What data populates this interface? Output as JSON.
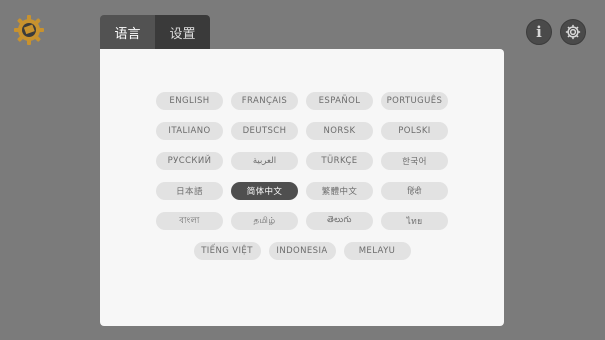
{
  "app": {
    "icons": {
      "logo": "gear-sun-logo",
      "info": "info-icon",
      "settings": "gear-icon"
    },
    "info_glyph": "i"
  },
  "tabs": [
    {
      "label": "语言",
      "active": true
    },
    {
      "label": "设置",
      "active": false
    }
  ],
  "languages": {
    "selected": "简体中文",
    "rows": [
      [
        "ENGLISH",
        "FRANÇAIS",
        "ESPAÑOL",
        "PORTUGUÊS"
      ],
      [
        "ITALIANO",
        "DEUTSCH",
        "NORSK",
        "POLSKI"
      ],
      [
        "РУССКИЙ",
        "العربية",
        "TÜRKÇE",
        "한국어"
      ],
      [
        "日本語",
        "简体中文",
        "繁體中文",
        "हिंदी"
      ],
      [
        "বাংলা",
        "தமிழ்",
        "తెలుగు",
        "ไทย"
      ],
      [
        "TIẾNG VIỆT",
        "INDONESIA",
        "MELAYU"
      ]
    ]
  },
  "colors": {
    "background": "#7b7b7b",
    "panel": "#f7f7f7",
    "pill": "#e2e2e2",
    "pill_selected": "#4f4f4f",
    "logo": "#c8922e"
  }
}
